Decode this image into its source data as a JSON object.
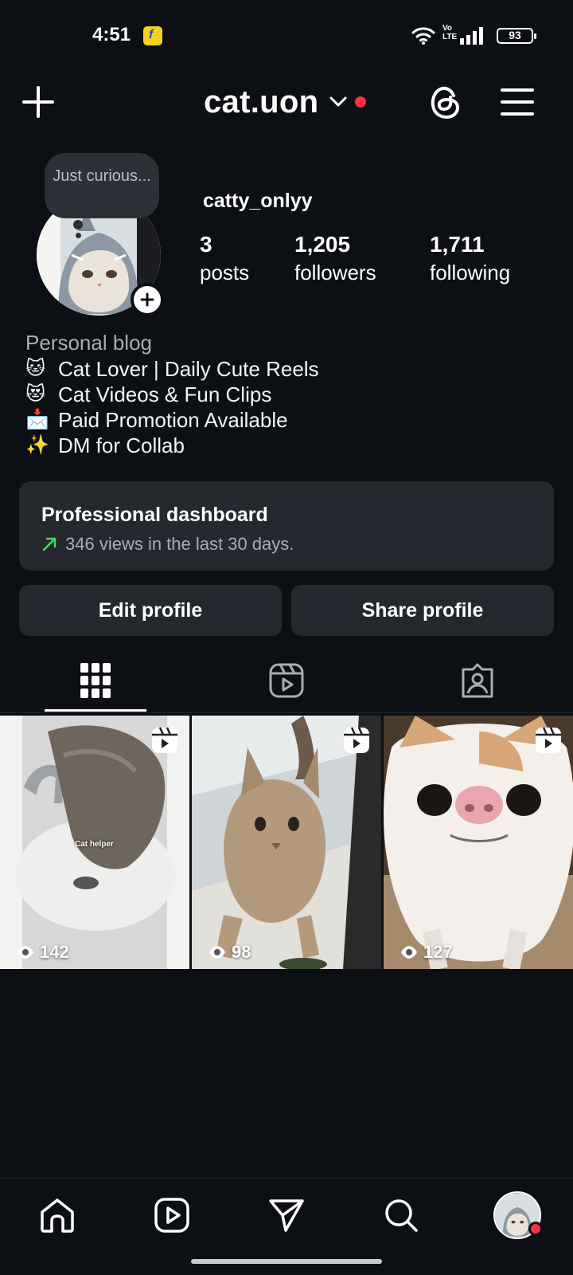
{
  "status_bar": {
    "time": "4:51",
    "battery": "93",
    "network_label": "Vo LTE"
  },
  "header": {
    "username": "cat.uon",
    "icons": [
      "plus-icon",
      "chevron-down-icon",
      "threads-icon",
      "menu-icon"
    ],
    "notification_color": "#ff3040"
  },
  "profile": {
    "note_bubble": "Just curious...",
    "display_name": "catty_onlyy",
    "stats": [
      {
        "value": "3",
        "label": "posts"
      },
      {
        "value": "1,205",
        "label": "followers"
      },
      {
        "value": "1,711",
        "label": "following"
      }
    ]
  },
  "bio": {
    "category": "Personal blog",
    "lines": [
      {
        "emoji": "🐱",
        "text": "Cat Lover | Daily Cute Reels"
      },
      {
        "emoji": "😻",
        "text": "Cat Videos & Fun Clips"
      },
      {
        "emoji": "📩",
        "text": "Paid Promotion Available"
      },
      {
        "emoji": "✨",
        "text": "DM for Collab"
      }
    ]
  },
  "dashboard": {
    "title": "Professional dashboard",
    "subtitle": "346 views in the last 30 days.",
    "trend_color": "#4cd964"
  },
  "actions": {
    "edit_label": "Edit profile",
    "share_label": "Share profile"
  },
  "tabs": [
    "grid-icon",
    "reels-icon",
    "tagged-icon"
  ],
  "posts": [
    {
      "views": "142",
      "caption": "Cat helper"
    },
    {
      "views": "98"
    },
    {
      "views": "127"
    }
  ],
  "bottom_nav": [
    "home-icon",
    "reels-icon",
    "messages-icon",
    "search-icon",
    "profile-avatar"
  ],
  "colors": {
    "background": "#0c0f14",
    "surface": "#25292f",
    "secondary_text": "#a8adb4"
  }
}
